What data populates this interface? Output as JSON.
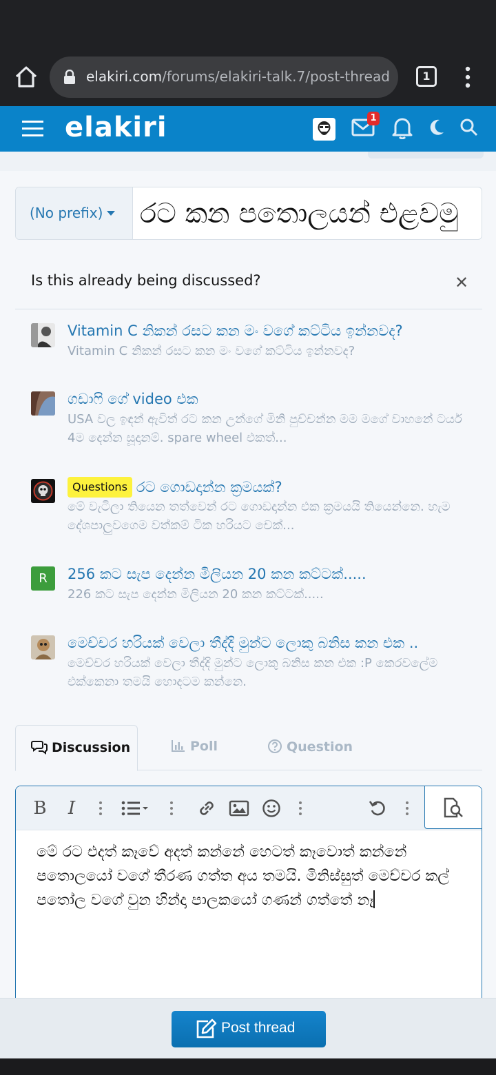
{
  "browser": {
    "url_host": "elakiri.com",
    "url_path": "/forums/elakiri-talk.7/post-thread",
    "tab_count": "1"
  },
  "site": {
    "logo": "elakiri",
    "notification_badge": "1",
    "brand_color": "#0a83c9"
  },
  "title_row": {
    "prefix_label": "(No prefix)",
    "title_value": "රට කන පතොලයන් එළවමු"
  },
  "similar": {
    "heading": "Is this already being discussed?",
    "close_symbol": "✕",
    "threads": [
      {
        "title": "Vitamin C නිකන් රසට කන මං වගේ කට්ටිය ඉන්නවද?",
        "snippet": "Vitamin C නිකන් රසට කන මං වගේ කට්ටිය ඉන්නවද?"
      },
      {
        "title": "ගඩාෆි ගේ video එක",
        "snippet": "USA වල ඉඳන් ඇවිත් රට කන උන්ගේ මිනි පුච්චන්න මම මගේ වාහනේ ටයර් 4ම දෙන්න සූදානම්. spare wheel එකත්..."
      },
      {
        "prefix": "Questions",
        "title": "රට ගොඩදාන්න ක්‍රමයක්?",
        "snippet": "මේ වැටිලා තියෙන තත්වෙන් රට ගොඩදාන්න එක ක්‍රමයයි තියෙන්නෙ. හැම දේශපාලුවගෙම වත්කම් ටික හරියට චෙක්..."
      },
      {
        "title": "256 කට සැප දෙන්න මිලියන 20 කන කට්ටක්.....",
        "snippet": "226 කට සැප දෙන්න මිලියන 20 කන කට්ටක්.....",
        "avatar_letter": "R"
      },
      {
        "title": "මෙච්චර හරියක් වෙලා තීද්දි මුන්ට ලොකු බනිස කන එක ..",
        "snippet": "මෙච්චර හරියක් වෙලා තීද්දි මුන්ට ලොකු බනිස කන එක :P කෙරවලේම එක්කෙනා තමයි හොදටම කන්නෙ."
      }
    ]
  },
  "tabs": {
    "discussion": "Discussion",
    "poll": "Poll",
    "question": "Question"
  },
  "editor": {
    "text": "මේ රට එදත් කෑවේ අදත් කන්නේ හෙටත් කෑවොත් කන්නේ පතොලයෝ වගේ තීරණ ගත්ත අය තමයි. මිනිස්සුත් මෙච්චර කල් පතෝල වගේ වුන හින්දා පාලකයෝ ගණන් ගත්තේ නෑ"
  },
  "footer": {
    "post_button": "Post thread"
  }
}
